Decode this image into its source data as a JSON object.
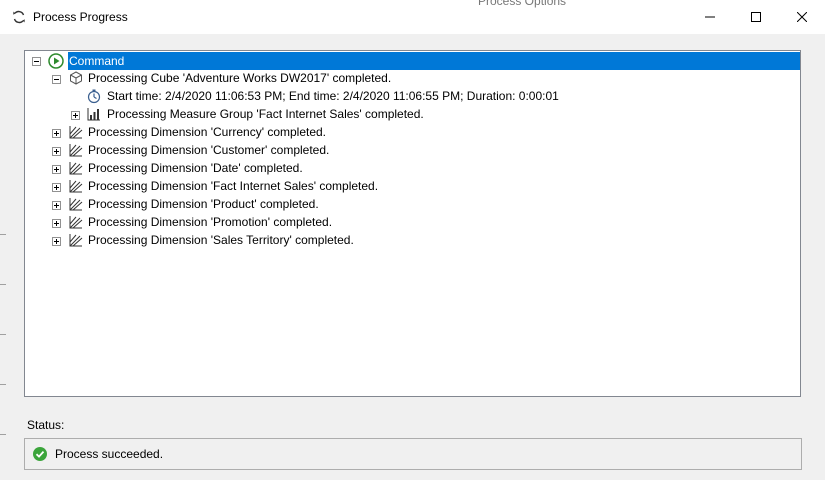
{
  "window": {
    "title": "Process Progress",
    "background_label": "Process Options",
    "controls": {
      "minimize": "minimize-icon",
      "maximize": "maximize-icon",
      "close": "close-icon"
    }
  },
  "colors": {
    "selection": "#0078d7",
    "success": "#3ba53b",
    "client": "#f0f0f0",
    "border": "#828790"
  },
  "tree": {
    "command": "Command",
    "cube": {
      "text": "Processing Cube 'Adventure Works DW2017' completed.",
      "time": "Start time: 2/4/2020 11:06:53 PM; End time: 2/4/2020 11:06:55 PM; Duration: 0:00:01",
      "measure_group": "Processing Measure Group 'Fact Internet Sales' completed."
    },
    "dimensions": [
      "Processing Dimension 'Currency' completed.",
      "Processing Dimension 'Customer' completed.",
      "Processing Dimension 'Date' completed.",
      "Processing Dimension 'Fact Internet Sales' completed.",
      "Processing Dimension 'Product' completed.",
      "Processing Dimension 'Promotion' completed.",
      "Processing Dimension 'Sales Territory' completed."
    ]
  },
  "status": {
    "label": "Status:",
    "text": "Process succeeded.",
    "icon": "check-circle-icon"
  }
}
